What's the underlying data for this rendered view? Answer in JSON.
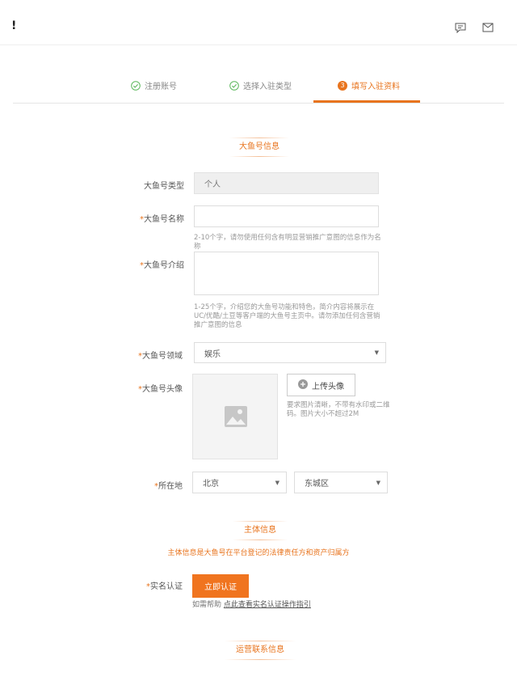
{
  "header": {
    "logo_fragment": "!",
    "icons": [
      "message-icon",
      "mail-icon"
    ]
  },
  "steps": [
    {
      "label": "注册账号",
      "status": "done"
    },
    {
      "label": "选择入驻类型",
      "status": "done"
    },
    {
      "label": "填写入驻资料",
      "status": "active",
      "number": "3"
    }
  ],
  "account_section": {
    "title": "大鱼号信息",
    "type": {
      "label": "大鱼号类型",
      "value": "个人"
    },
    "name": {
      "required_mark": "*",
      "label": "大鱼号名称",
      "value": "",
      "hint": "2-10个字，请勿使用任何含有明显营销推广意图的信息作为名称"
    },
    "intro": {
      "required_mark": "*",
      "label": "大鱼号介绍",
      "value": "",
      "hint": "1-25个字，介绍您的大鱼号功能和特色，简介内容将展示在UC/优酷/土豆等客户端的大鱼号主页中。请勿添加任何含营销推广意图的信息"
    },
    "field": {
      "required_mark": "*",
      "label": "大鱼号领域",
      "value": "娱乐"
    },
    "avatar": {
      "required_mark": "*",
      "label": "大鱼号头像",
      "upload_label": "上传头像",
      "hint": "要求图片清晰，不带有水印或二维码。图片大小不超过2M"
    },
    "location": {
      "required_mark": "*",
      "label": "所在地",
      "province": "北京",
      "district": "东城区"
    }
  },
  "subject_section": {
    "title": "主体信息",
    "desc": "主体信息是大鱼号在平台登记的法律责任方和资产归属方",
    "verify": {
      "required_mark": "*",
      "label": "实名认证",
      "button": "立即认证",
      "help_prefix": "如需帮助",
      "help_link": "点此查看实名认证操作指引"
    }
  },
  "contact_section": {
    "title": "运营联系信息"
  }
}
